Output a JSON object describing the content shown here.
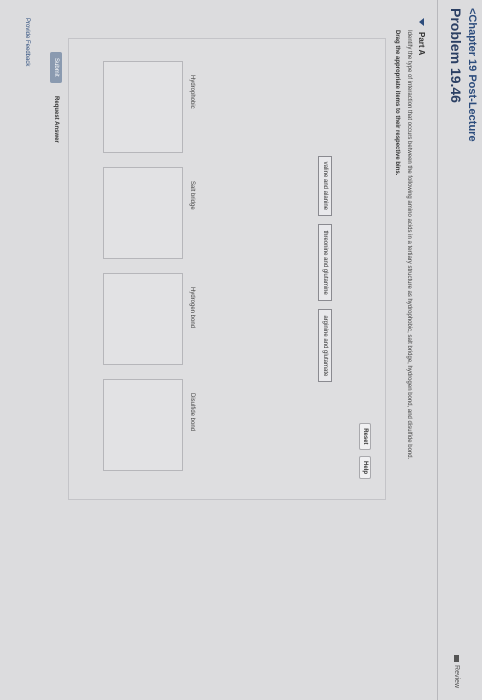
{
  "header": {
    "back_link": "<Chapter 19 Post-Lecture",
    "title": "Problem 19.46",
    "preview": "Review"
  },
  "part": {
    "label": "Part A",
    "instruction": "Identify the type of interaction that occurs between the following amino acids in a tertiary structure as hydrophobic, salt bridge, hydrogen bond, and disulfide bond.",
    "drag_instruction": "Drag the appropriate items to their respective bins."
  },
  "controls": {
    "reset": "Reset",
    "help": "Help"
  },
  "tiles": [
    "valine and alanine",
    "threonine and glutamine",
    "arginine and glutamate"
  ],
  "bins": [
    {
      "label": "Hydrophobic"
    },
    {
      "label": "Salt bridge"
    },
    {
      "label": "Hydrogen bond"
    },
    {
      "label": "Disulfide bond"
    }
  ],
  "footer": {
    "submit": "Submit",
    "request_answer": "Request Answer",
    "feedback": "Provide Feedback"
  }
}
